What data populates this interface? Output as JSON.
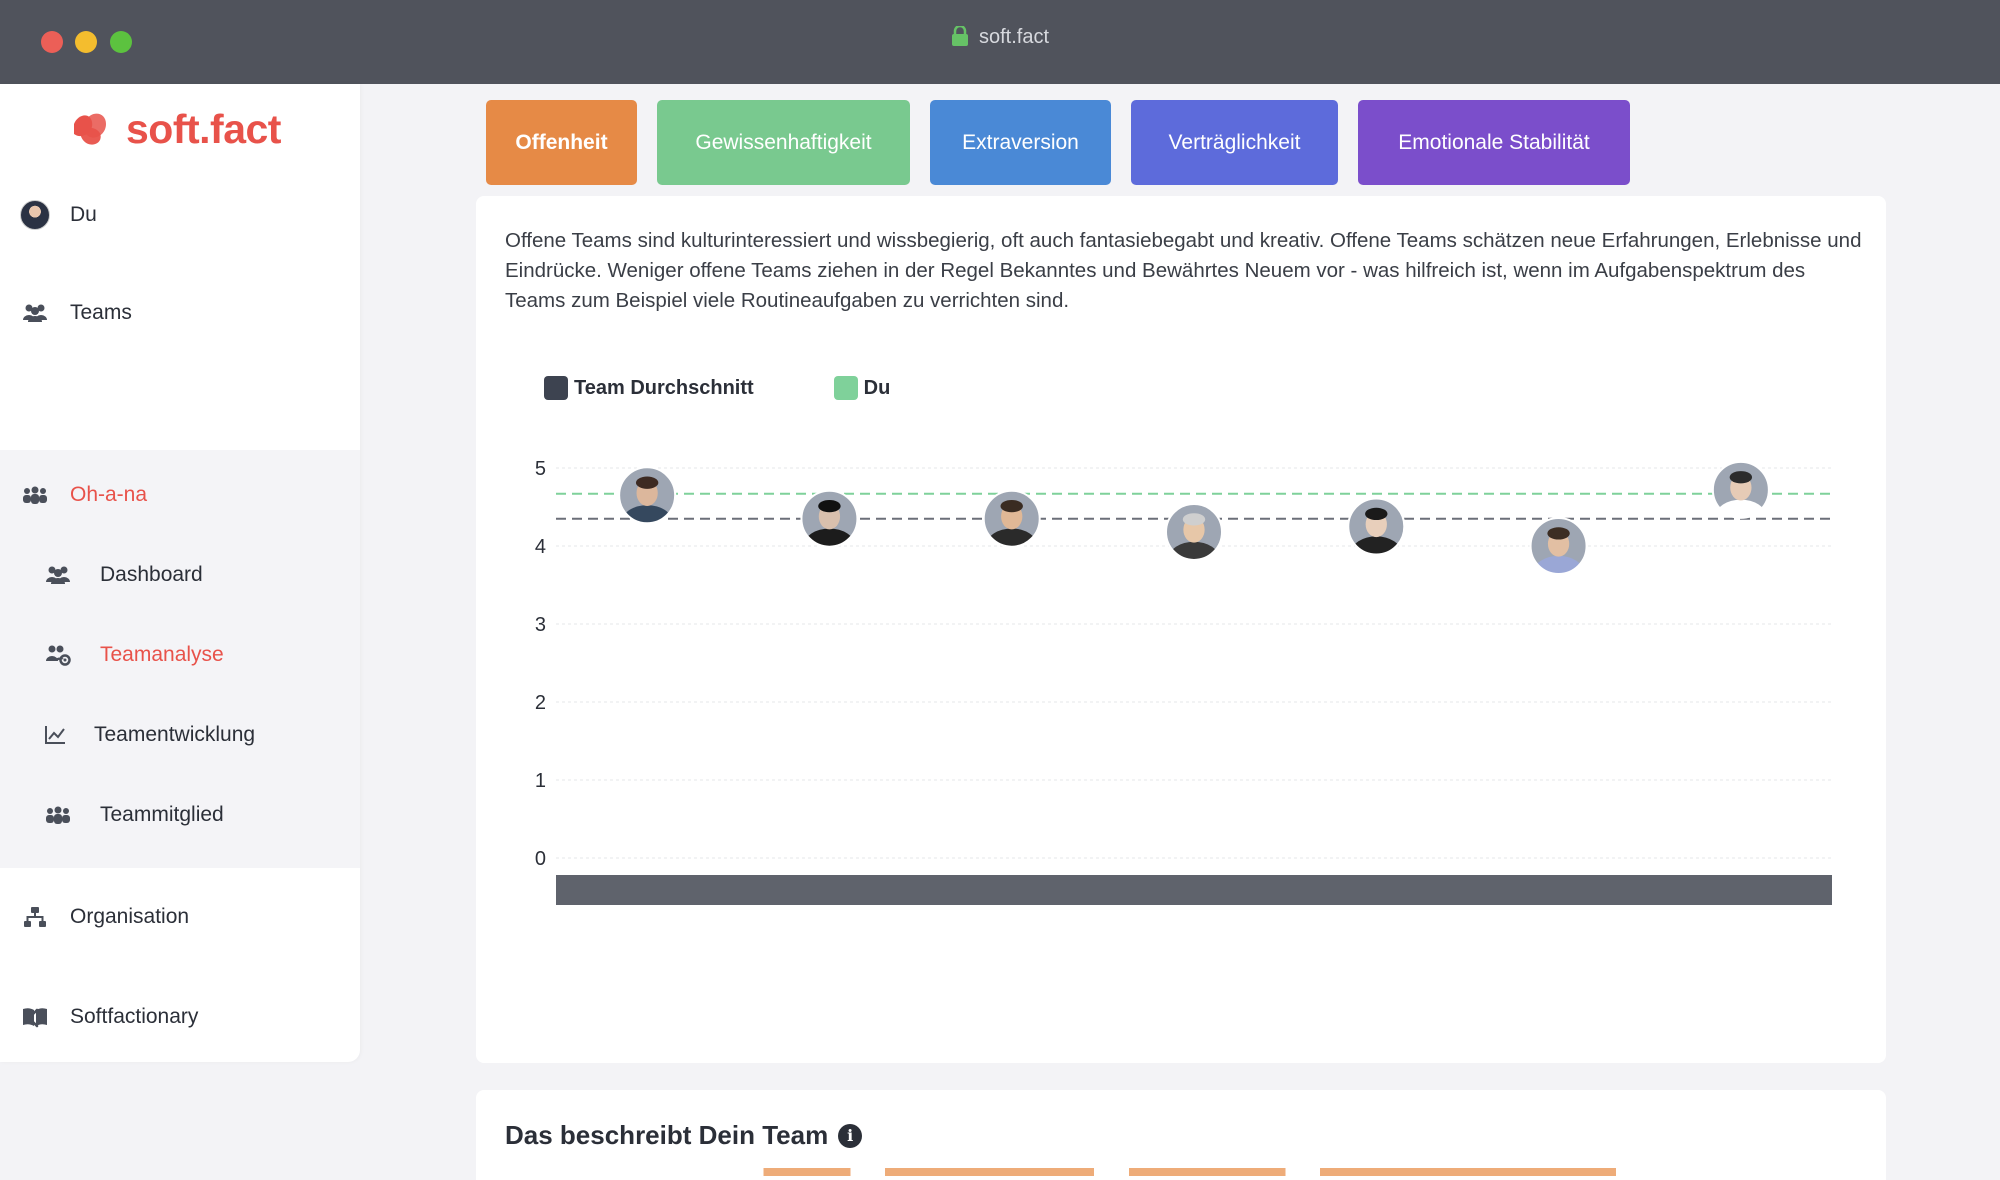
{
  "window": {
    "url": "soft.fact"
  },
  "brand": {
    "name": "soft.fact",
    "color": "#e8524a"
  },
  "sidebar": {
    "top_items": [
      {
        "label": "Du",
        "icon": "user-avatar"
      },
      {
        "label": "Teams",
        "icon": "users-icon"
      }
    ],
    "team": {
      "label": "Oh-a-na",
      "icon": "people-group-icon",
      "active": true
    },
    "sub_items": [
      {
        "label": "Dashboard",
        "icon": "users-icon"
      },
      {
        "label": "Teamanalyse",
        "icon": "users-cog-icon",
        "active": true
      },
      {
        "label": "Teamentwicklung",
        "icon": "line-chart-icon"
      },
      {
        "label": "Teammitglied",
        "icon": "people-group-icon"
      }
    ],
    "bottom_items": [
      {
        "label": "Organisation",
        "icon": "sitemap-icon"
      },
      {
        "label": "Softfactionary",
        "icon": "book-icon"
      }
    ]
  },
  "tabs": [
    {
      "label": "Offenheit",
      "color": "#e68a46",
      "active": true
    },
    {
      "label": "Gewissenhaftigkeit",
      "color": "#79c98f"
    },
    {
      "label": "Extraversion",
      "color": "#4a89d6"
    },
    {
      "label": "Verträglichkeit",
      "color": "#5d6bdb"
    },
    {
      "label": "Emotionale Stabilität",
      "color": "#7b4ecb"
    }
  ],
  "description": "Offene Teams sind kulturinteressiert und wissbegierig, oft auch fantasiebegabt und kreativ. Offene Teams schätzen neue Erfahrungen, Erlebnisse und Eindrücke. Weniger offene Teams ziehen in der Regel Bekanntes und Bewährtes Neuem vor - was hilfreich ist, wenn im Aufgabenspektrum des Teams zum Beispiel viele Routineaufgaben zu verrichten sind.",
  "chart_data": {
    "type": "scatter",
    "legend": [
      {
        "name": "Team Durchschnitt",
        "color": "#3d4350"
      },
      {
        "name": "Du",
        "color": "#7fd19a"
      }
    ],
    "legend_position": "top-left",
    "ylim": [
      0,
      5
    ],
    "yticks": [
      "0",
      "1",
      "2",
      "3",
      "4",
      "5"
    ],
    "grid": true,
    "team_average": 4.35,
    "du_value": 4.67,
    "members": [
      {
        "value": 4.65,
        "photo": "avatar-man-glasses"
      },
      {
        "value": 4.35,
        "photo": "avatar-man-dark"
      },
      {
        "value": 4.35,
        "photo": "avatar-man-beard"
      },
      {
        "value": 4.18,
        "photo": "avatar-man-cap"
      },
      {
        "value": 4.25,
        "photo": "avatar-woman-dark-hair"
      },
      {
        "value": 4.0,
        "photo": "avatar-man-light"
      },
      {
        "value": 4.72,
        "photo": "avatar-woman-sea"
      }
    ]
  },
  "section2": {
    "title": "Das beschreibt Dein Team"
  }
}
